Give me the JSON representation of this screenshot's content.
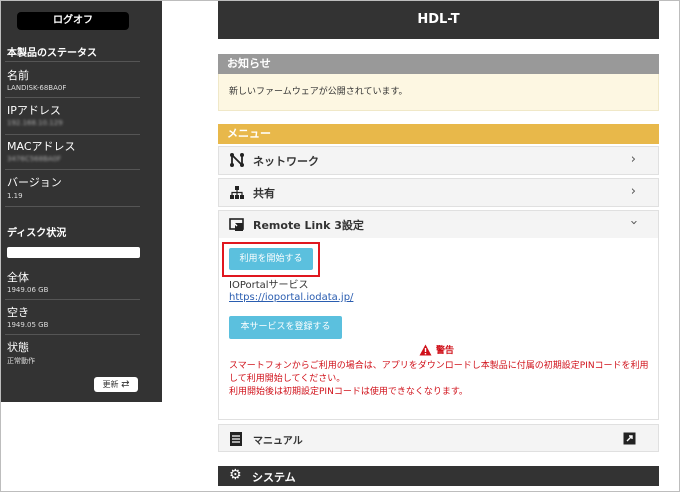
{
  "sidebar": {
    "logoff_label": "ログオフ",
    "status_heading": "本製品のステータス",
    "name_label": "名前",
    "name_value": "LANDISK-68BA0F",
    "ip_label": "IPアドレス",
    "ip_value": "192.168.10.129",
    "mac_label": "MACアドレス",
    "mac_value": "3476C568BA0F",
    "version_label": "バージョン",
    "version_value": "1.19",
    "disk_heading": "ディスク状況",
    "total_label": "全体",
    "total_value": "1949.06 GB",
    "free_label": "空き",
    "free_value": "1949.05 GB",
    "state_label": "状態",
    "state_value": "正常動作",
    "refresh_label": "更新"
  },
  "header": {
    "title": "HDL-T"
  },
  "notice": {
    "heading": "お知らせ",
    "message": "新しいファームウェアが公開されています。"
  },
  "menu": {
    "heading": "メニュー",
    "items": [
      {
        "label": "ネットワーク",
        "icon": "network-icon"
      },
      {
        "label": "共有",
        "icon": "share-icon"
      },
      {
        "label": "Remote Link 3設定",
        "icon": "remote-link-icon"
      }
    ]
  },
  "remote_link": {
    "start_button": "利用を開始する",
    "service_title": "IOPortalサービス",
    "service_link": "https://ioportal.iodata.jp/",
    "register_button": "本サービスを登録する",
    "warning_title": "警告",
    "warning_line1": "スマートフォンからご利用の場合は、アプリをダウンロードし本製品に付属の初期設定PINコードを利用",
    "warning_line2": "して利用開始してください。",
    "warning_line3": "利用開始後は初期設定PINコードは使用できなくなります。"
  },
  "manual": {
    "label": "マニュアル",
    "icon": "external-link-icon"
  },
  "system": {
    "label": "システム",
    "icon": "gear-icon"
  },
  "colors": {
    "dark": "#333333",
    "menu_accent": "#e8b84a",
    "notice_bg": "#fdf7e2",
    "button": "#5bc0de",
    "warning": "#d0111a",
    "highlight": "#e0171f"
  }
}
